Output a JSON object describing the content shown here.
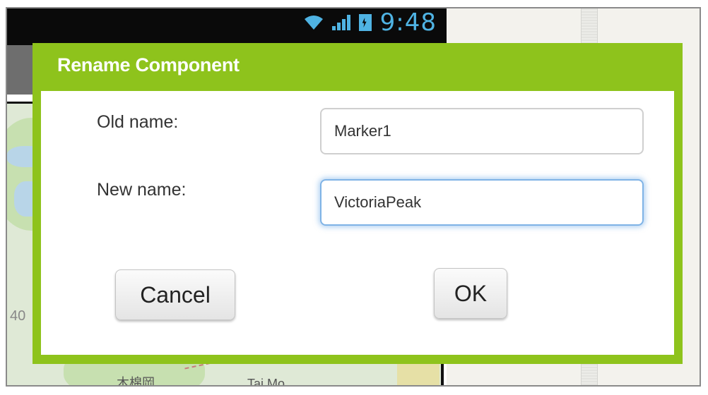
{
  "status_bar": {
    "time": "9:48",
    "icons": [
      "wifi-icon",
      "signal-icon",
      "battery-charging-icon"
    ],
    "icon_color": "#4fb3e3"
  },
  "map": {
    "labels": {
      "tai_mo": "Tai Mo",
      "chinese_place": "木棉岡",
      "side": "40"
    }
  },
  "dialog": {
    "title": "Rename Component",
    "accent_color": "#8ec31c",
    "old_name_label": "Old name:",
    "old_name_value": "Marker1",
    "new_name_label": "New name:",
    "new_name_value": "VictoriaPeak",
    "cancel_label": "Cancel",
    "ok_label": "OK"
  }
}
